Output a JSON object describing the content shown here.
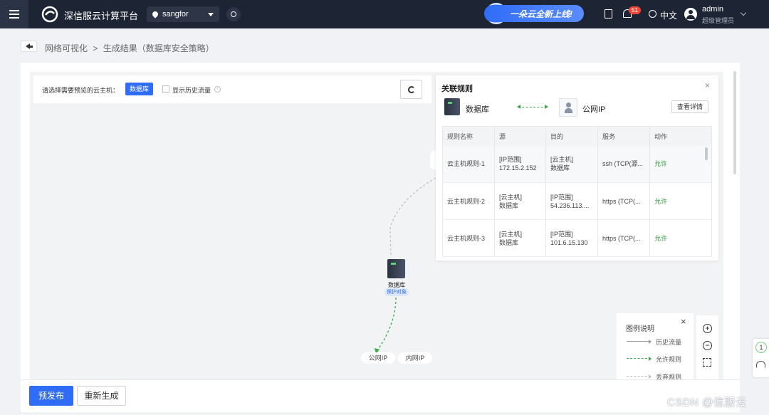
{
  "topbar": {
    "brand": "深信服云计算平台",
    "region": "sangfor",
    "promo": "一朵云全新上线!",
    "notification_count": "51",
    "language": "中文",
    "user_name": "admin",
    "user_role": "超级管理员"
  },
  "breadcrumb": {
    "items": [
      "网络可视化",
      ">",
      "生成结果（数据库安全策略）"
    ]
  },
  "selector": {
    "label": "请选择需要预览的云主机：",
    "selected_vm": "数据库",
    "show_history_label": "显示历史流量",
    "info_glyph": "i"
  },
  "rules_panel": {
    "title": "关联规则",
    "close": "×",
    "source": "数据库",
    "destination": "公网IP",
    "detail_button": "查看详情",
    "columns": [
      "规则名称",
      "源",
      "目的",
      "服务",
      "动作"
    ],
    "rows": [
      {
        "name": "云主机规则-1",
        "src": "[IP范围]\n172.15.2.152",
        "dst": "[云主机]\n数据库",
        "service": "ssh (TCP(源...",
        "action": "允许"
      },
      {
        "name": "云主机规则-2",
        "src": "[云主机]\n数据库",
        "dst": "[IP范围]\n54.236.113....",
        "service": "https (TCP(...",
        "action": "允许"
      },
      {
        "name": "云主机规则-3",
        "src": "[云主机]\n数据库",
        "dst": "[IP范围]\n101.6.15.130",
        "service": "https (TCP(...",
        "action": "允许"
      }
    ]
  },
  "topology": {
    "node_label": "数据库",
    "node_tag": "保护对象",
    "public_ip": "公网IP",
    "internal_ip": "内网IP"
  },
  "legend": {
    "title": "图例说明",
    "close": "×",
    "items": [
      "历史流量",
      "允许规则",
      "丢弃规则"
    ]
  },
  "zoom": {
    "in": "+",
    "out": "−"
  },
  "side": {
    "count": "1"
  },
  "footer": {
    "publish": "预发布",
    "regenerate": "重新生成"
  },
  "watermark": "CSDN @信服云",
  "colors": {
    "topbar": "#1d2433",
    "primary": "#2f6df6",
    "allow": "#2e9b3c",
    "canvas": "#f2f3f5"
  }
}
